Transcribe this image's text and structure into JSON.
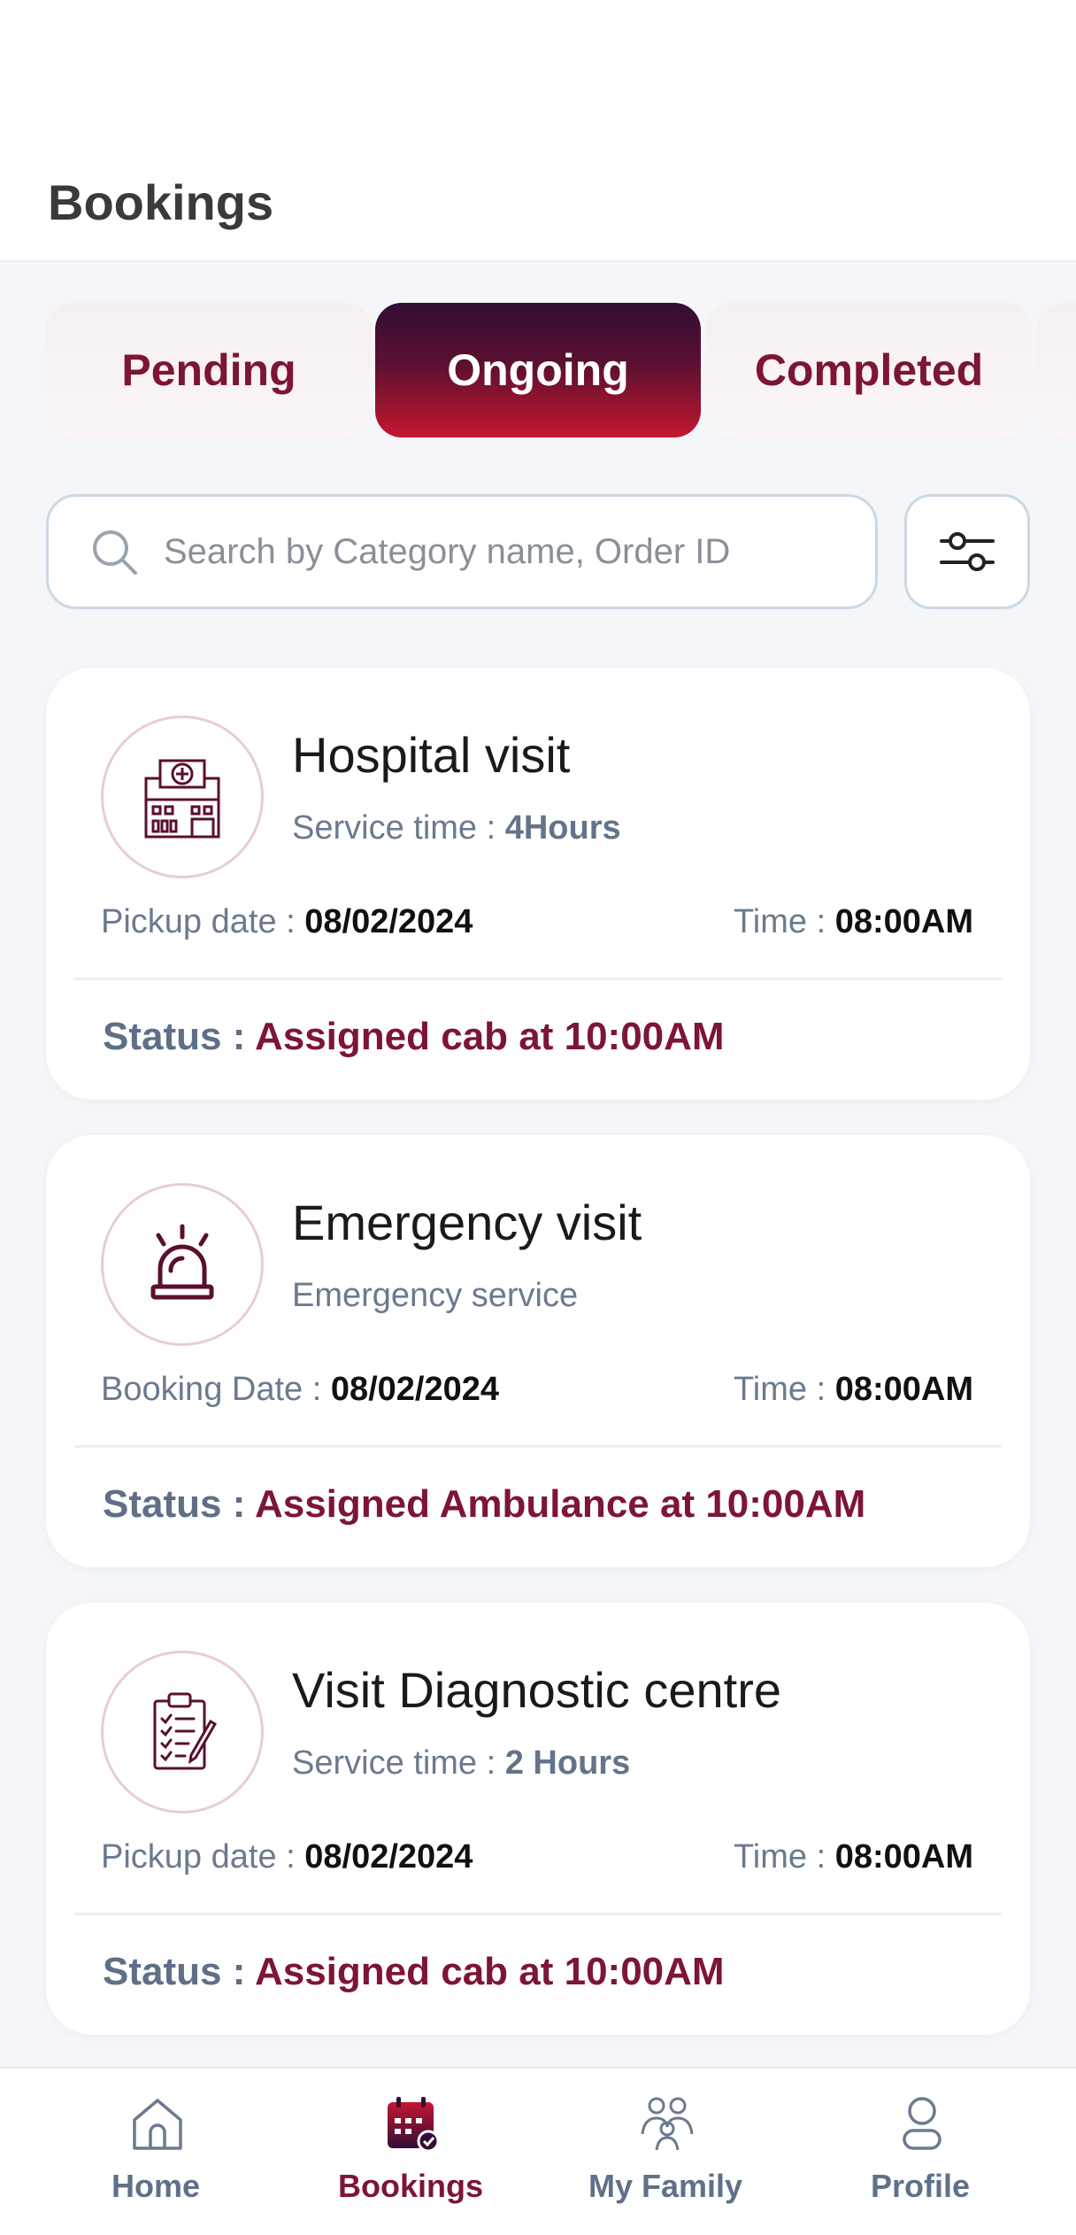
{
  "header": {
    "title": "Bookings"
  },
  "tabs": [
    {
      "label": "Pending",
      "active": false
    },
    {
      "label": "Ongoing",
      "active": true
    },
    {
      "label": "Completed",
      "active": false
    }
  ],
  "search": {
    "placeholder": "Search by Category name, Order ID"
  },
  "bookings": [
    {
      "icon": "hospital-icon",
      "title": "Hospital visit",
      "sub_label": "Service time : ",
      "sub_value": "4Hours",
      "date_label": "Pickup date : ",
      "date_value": "08/02/2024",
      "time_label": "Time : ",
      "time_value": "08:00AM",
      "status_label": "Status : ",
      "status_value": "Assigned cab at 10:00AM"
    },
    {
      "icon": "siren-icon",
      "title": "Emergency visit",
      "sub_label": "Emergency service",
      "sub_value": "",
      "date_label": "Booking Date : ",
      "date_value": "08/02/2024",
      "time_label": "Time : ",
      "time_value": "08:00AM",
      "status_label": "Status : ",
      "status_value": "Assigned Ambulance at 10:00AM"
    },
    {
      "icon": "clipboard-icon",
      "title": "Visit Diagnostic centre",
      "sub_label": "Service time : ",
      "sub_value": "2 Hours",
      "date_label": "Pickup date : ",
      "date_value": "08/02/2024",
      "time_label": "Time : ",
      "time_value": "08:00AM",
      "status_label": "Status : ",
      "status_value": "Assigned cab at 10:00AM"
    }
  ],
  "nav": [
    {
      "label": "Home",
      "icon": "home-icon",
      "active": false
    },
    {
      "label": "Bookings",
      "icon": "calendar-icon",
      "active": true
    },
    {
      "label": "My Family",
      "icon": "family-icon",
      "active": false
    },
    {
      "label": "Profile",
      "icon": "profile-icon",
      "active": false
    }
  ],
  "colors": {
    "accent": "#7d1535",
    "tab_gradient_top": "#330d35",
    "tab_gradient_bottom": "#c5172f",
    "muted_text": "#6b7a8f"
  }
}
